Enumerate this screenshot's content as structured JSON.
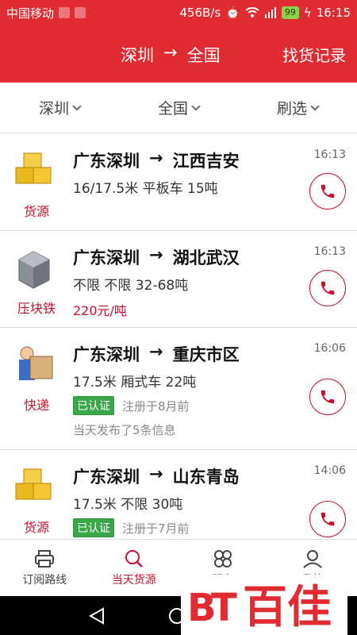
{
  "statusbar": {
    "carrier": "中国移动",
    "speed": "456B/s",
    "battery": "99",
    "time": "16:15"
  },
  "header": {
    "from": "深圳",
    "arrow": "→",
    "to": "全国",
    "history_label": "找货记录"
  },
  "filters": {
    "origin": "深圳",
    "destination": "全国",
    "filter": "刷选"
  },
  "listings": [
    {
      "category": "货源",
      "from": "广东深圳",
      "arrow": "→",
      "to": "江西吉安",
      "time": "16:13",
      "spec": "16/17.5米 平板车 15吨"
    },
    {
      "category": "压块铁",
      "from": "广东深圳",
      "arrow": "→",
      "to": "湖北武汉",
      "time": "16:13",
      "spec": "不限 不限 32-68吨",
      "price": "220元/吨"
    },
    {
      "category": "快递",
      "from": "广东深圳",
      "arrow": "→",
      "to": "重庆市区",
      "time": "16:06",
      "spec": "17.5米 厢式车 22吨",
      "badge": "已认证",
      "registered": "注册于8月前",
      "note": "当天发布了5条信息"
    },
    {
      "category": "货源",
      "from": "广东深圳",
      "arrow": "→",
      "to": "山东青岛",
      "time": "14:06",
      "spec": "17.5米 不限 30吨",
      "badge": "已认证",
      "registered": "注册于7月前"
    }
  ],
  "tabs": [
    {
      "label": "订阅路线",
      "icon": "printer-icon"
    },
    {
      "label": "当天货源",
      "icon": "search-icon"
    },
    {
      "label": "服务",
      "icon": "grid-icon"
    },
    {
      "label": "我的",
      "icon": "user-icon"
    }
  ],
  "watermark": {
    "text": "百佳"
  },
  "colors": {
    "brand_red": "#e02b33",
    "accent_red": "#c8102e",
    "verified_green": "#3aa84a"
  }
}
